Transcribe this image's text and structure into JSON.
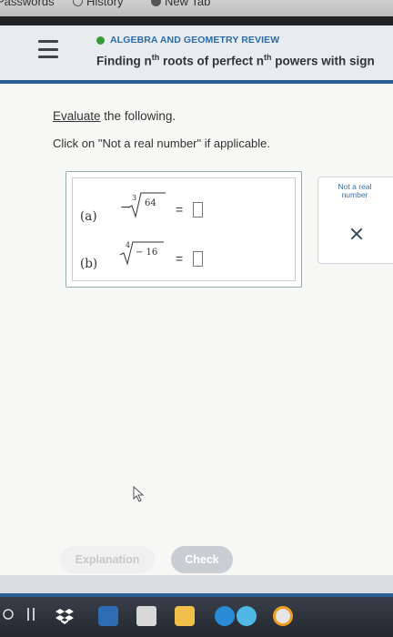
{
  "bookmarks": [
    {
      "label": "Passwords"
    },
    {
      "label": "History"
    },
    {
      "label": "New Tab"
    }
  ],
  "header": {
    "section": "ALGEBRA AND GEOMETRY REVIEW",
    "title_part1": "Finding n",
    "title_sup1": "th",
    "title_part2": " roots of perfect n",
    "title_sup2": "th",
    "title_part3": " powers with sign"
  },
  "instructions": {
    "evaluate_link": "Evaluate",
    "evaluate_rest": " the following.",
    "line2": "Click on \"Not a real number\" if applicable."
  },
  "problems": [
    {
      "label": "(a)",
      "sign": "−",
      "index": "3",
      "radicand": "64",
      "equals": "="
    },
    {
      "label": "(b)",
      "sign": "",
      "index": "4",
      "radicand": "− 16",
      "equals": "="
    }
  ],
  "side_panel": {
    "not_real_label": "Not a real number"
  },
  "buttons": {
    "explanation": "Explanation",
    "check": "Check"
  },
  "colors": {
    "accent_blue": "#2a5d93",
    "section_green": "#3a9a3a",
    "link_blue": "#2a6aa8"
  }
}
